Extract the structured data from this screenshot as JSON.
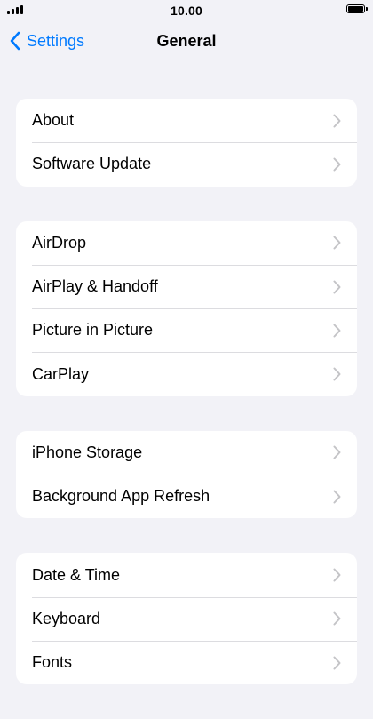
{
  "status_bar": {
    "time": "10.00",
    "signal_icon": "signal-bars-icon",
    "battery_icon": "battery-icon"
  },
  "nav": {
    "back_label": "Settings",
    "back_icon": "chevron-left-icon",
    "title": "General"
  },
  "groups": [
    {
      "items": [
        {
          "label": "About"
        },
        {
          "label": "Software Update"
        }
      ]
    },
    {
      "items": [
        {
          "label": "AirDrop"
        },
        {
          "label": "AirPlay & Handoff"
        },
        {
          "label": "Picture in Picture"
        },
        {
          "label": "CarPlay"
        }
      ]
    },
    {
      "items": [
        {
          "label": "iPhone Storage"
        },
        {
          "label": "Background App Refresh"
        }
      ]
    },
    {
      "items": [
        {
          "label": "Date & Time"
        },
        {
          "label": "Keyboard"
        },
        {
          "label": "Fonts"
        }
      ]
    }
  ],
  "colors": {
    "accent": "#007aff",
    "background": "#f2f2f7",
    "cell": "#ffffff",
    "separator": "#dcdce0",
    "chevron": "#c4c4c7"
  }
}
